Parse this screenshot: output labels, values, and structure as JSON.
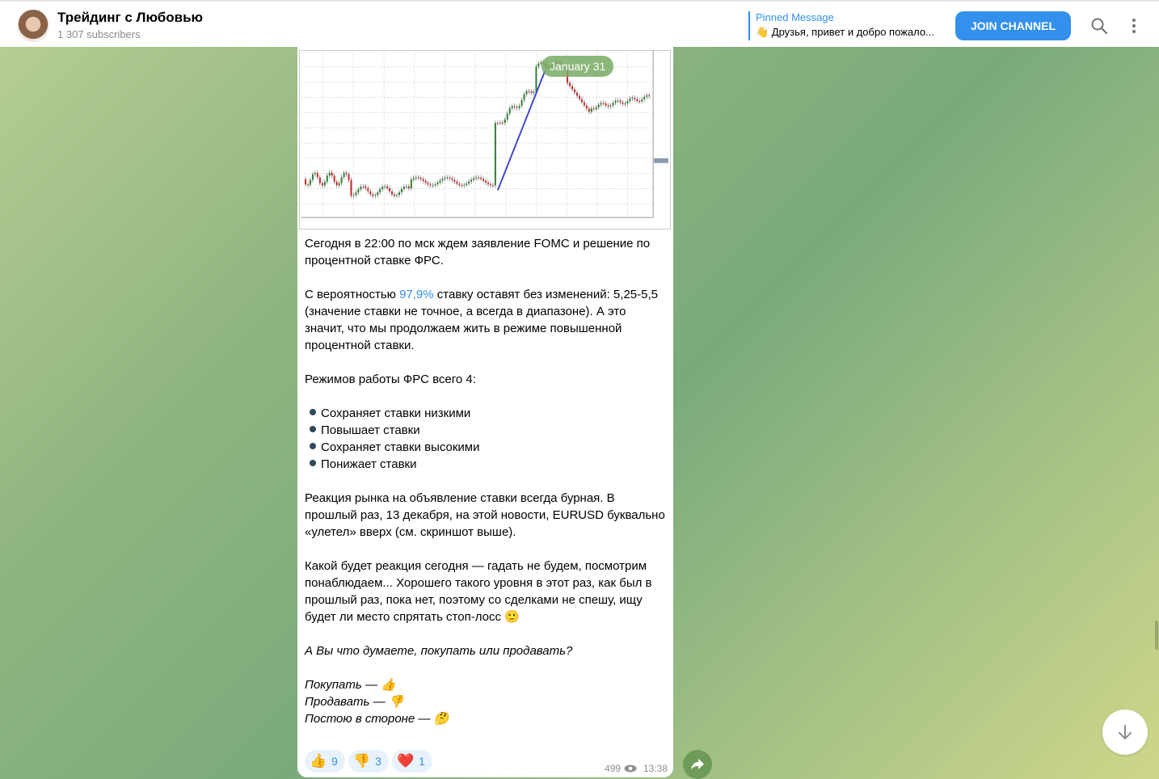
{
  "header": {
    "title": "Трейдинг с Любовью",
    "subscribers": "1 307 subscribers",
    "pinned_label": "Pinned Message",
    "pinned_text": "👋 Друзья, привет и добро пожало...",
    "join_label": "JOIN CHANNEL"
  },
  "message": {
    "date_pill": "January 31",
    "p1": "Сегодня в 22:00 по мск ждем заявление FOMC и решение по процентной ставке ФРС.",
    "p2_pre": "С вероятностью ",
    "p2_link": "97,9%",
    "p2_post": " ставку оставят без изменений: 5,25-5,5 (значение ставки не точное, а всегда в диапазоне). А это значит, что мы продолжаем жить в режиме повышенной процентной ставки.",
    "p3": "Режимов работы ФРС всего 4:",
    "list": [
      "Сохраняет ставки низкими",
      "Повышает ставки",
      "Сохраняет ставки высокими",
      "Понижает ставки"
    ],
    "p4": "Реакция рынка на объявление ставки всегда бурная. В прошлый раз, 13 декабря, на этой новости, EURUSD буквально «улетел» вверх (см. скриншот выше).",
    "p5": "Какой будет реакция сегодня — гадать не будем, посмотрим понаблюдаем... Хорошего такого уровня в этот раз, как был в прошлый раз, пока нет, поэтому со сделками не спешу, ищу будет ли место спрятать стоп-лосс 🙂",
    "p6": "А Вы что думаете, покупать или продавать?",
    "votes": [
      "Покупать — 👍",
      "Продавать — 👎",
      "Постою в стороне — 🤔"
    ],
    "reactions": [
      {
        "emoji": "👍",
        "count": "9"
      },
      {
        "emoji": "👎",
        "count": "3"
      },
      {
        "emoji": "❤️",
        "count": "1"
      }
    ],
    "views": "499",
    "time": "13:38"
  },
  "colors": {
    "accent": "#3390ec",
    "bull": "#2e7d32",
    "bear": "#c62828",
    "arrow": "#3f48cc"
  }
}
